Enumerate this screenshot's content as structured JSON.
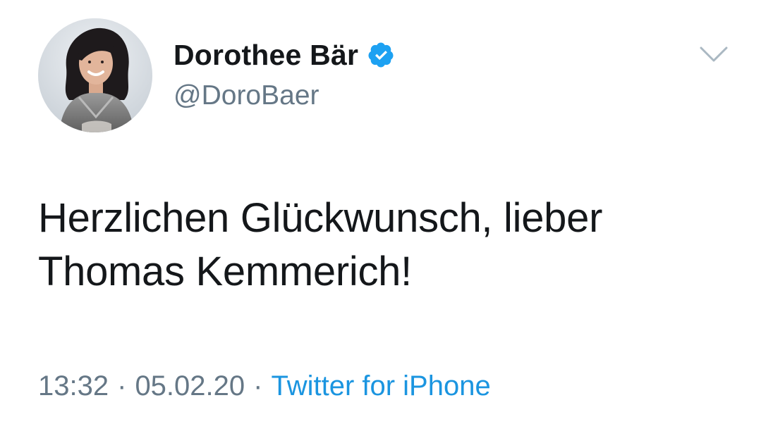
{
  "author": {
    "display_name": "Dorothee Bär",
    "handle": "@DoroBaer",
    "verified": true,
    "avatar_icon": "profile-photo"
  },
  "tweet": {
    "text": "Herzlichen Glückwunsch, lieber Thomas Kemmerich!"
  },
  "meta": {
    "time": "13:32",
    "date": "05.02.20",
    "separator": "·",
    "source": "Twitter for iPhone"
  },
  "icons": {
    "verified": "verified-badge-icon",
    "menu": "chevron-down-icon"
  },
  "colors": {
    "text_primary": "#14171a",
    "text_secondary": "#657786",
    "link": "#1b95e0",
    "verified_blue": "#1da1f2"
  }
}
